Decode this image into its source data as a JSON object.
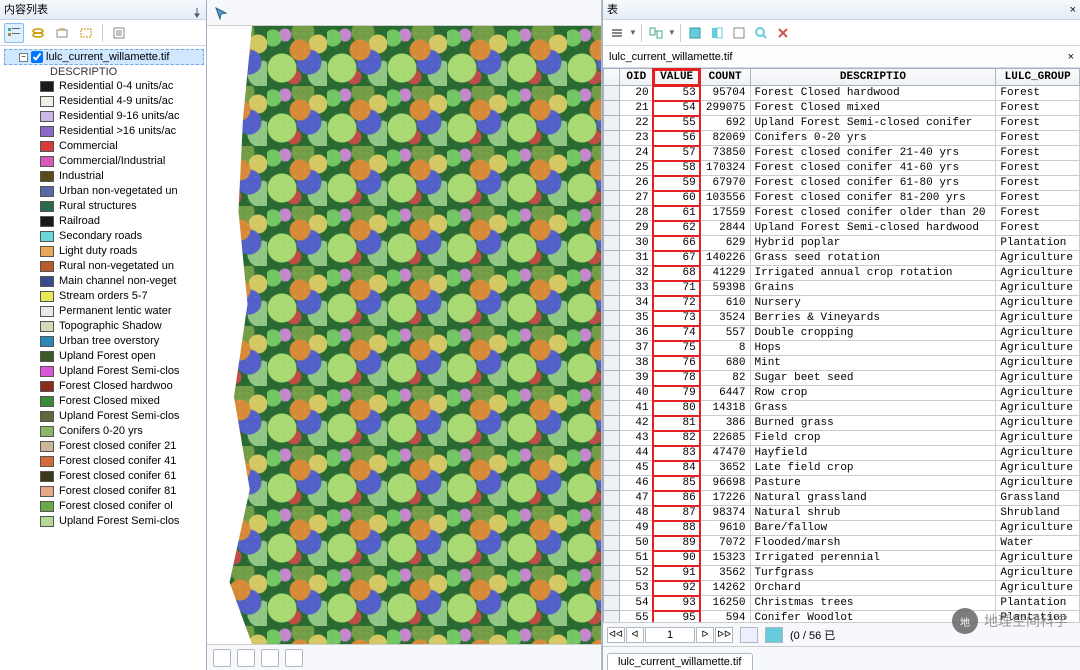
{
  "toc": {
    "title": "内容列表",
    "layerName": "lulc_current_willamette.tif",
    "legendHeader": "DESCRIPTIO",
    "legendItems": [
      {
        "color": "#1a1a1a",
        "label": "Residential 0-4 units/ac"
      },
      {
        "color": "#f0f0e8",
        "label": "Residential 4-9 units/ac"
      },
      {
        "color": "#c8b8e8",
        "label": "Residential 9-16 units/ac"
      },
      {
        "color": "#8a68c8",
        "label": "Residential >16 units/ac"
      },
      {
        "color": "#d83a3a",
        "label": "Commercial"
      },
      {
        "color": "#d858b8",
        "label": "Commercial/Industrial"
      },
      {
        "color": "#5a4a1a",
        "label": "Industrial"
      },
      {
        "color": "#5868a8",
        "label": "Urban non-vegetated un"
      },
      {
        "color": "#2a6a4a",
        "label": "Rural structures"
      },
      {
        "color": "#1a1a1a",
        "label": "Railroad"
      },
      {
        "color": "#68d8d8",
        "label": "Secondary roads"
      },
      {
        "color": "#e8a858",
        "label": "Light duty roads"
      },
      {
        "color": "#b85a2a",
        "label": "Rural non-vegetated un"
      },
      {
        "color": "#3a4a8a",
        "label": "Main channel non-veget"
      },
      {
        "color": "#e8e858",
        "label": "Stream orders 5-7"
      },
      {
        "color": "#e8e8e8",
        "label": "Permanent lentic water"
      },
      {
        "color": "#d8d8b8",
        "label": "Topographic Shadow"
      },
      {
        "color": "#2a88b8",
        "label": "Urban tree overstory"
      },
      {
        "color": "#3a5a2a",
        "label": "Upland Forest open"
      },
      {
        "color": "#d858d8",
        "label": "Upland Forest Semi-clos"
      },
      {
        "color": "#8a2a1a",
        "label": "Forest Closed hardwoo"
      },
      {
        "color": "#3a8a3a",
        "label": "Forest Closed mixed"
      },
      {
        "color": "#5a6a3a",
        "label": "Upland Forest Semi-clos"
      },
      {
        "color": "#8ab868",
        "label": "Conifers 0-20 yrs"
      },
      {
        "color": "#c8b898",
        "label": "Forest closed conifer 21"
      },
      {
        "color": "#d86a3a",
        "label": "Forest closed conifer 41"
      },
      {
        "color": "#3a3a1a",
        "label": "Forest closed conifer 61"
      },
      {
        "color": "#e8a888",
        "label": "Forest closed conifer 81"
      },
      {
        "color": "#6aa84a",
        "label": "Forest closed conifer ol"
      },
      {
        "color": "#b8d898",
        "label": "Upland Forest Semi-clos"
      }
    ]
  },
  "attributeTable": {
    "title": "表",
    "layerTab": "lulc_current_willamette.tif",
    "bottomTab": "lulc_current_willamette.tif",
    "columns": [
      "",
      "OID",
      "VALUE",
      "COUNT",
      "DESCRIPTIO",
      "LULC_GROUP"
    ],
    "navCurrent": "1",
    "navStatus": "(0 / 56 已",
    "rows": [
      {
        "oid": 20,
        "value": 53,
        "count": 95704,
        "desc": "Forest Closed hardwood",
        "group": "Forest"
      },
      {
        "oid": 21,
        "value": 54,
        "count": 299075,
        "desc": "Forest Closed mixed",
        "group": "Forest"
      },
      {
        "oid": 22,
        "value": 55,
        "count": 692,
        "desc": "Upland Forest Semi-closed conifer",
        "group": "Forest"
      },
      {
        "oid": 23,
        "value": 56,
        "count": 82069,
        "desc": "Conifers 0-20 yrs",
        "group": "Forest"
      },
      {
        "oid": 24,
        "value": 57,
        "count": 73850,
        "desc": "Forest closed conifer 21-40 yrs",
        "group": "Forest"
      },
      {
        "oid": 25,
        "value": 58,
        "count": 170324,
        "desc": "Forest closed conifer 41-60 yrs",
        "group": "Forest"
      },
      {
        "oid": 26,
        "value": 59,
        "count": 67970,
        "desc": "Forest closed conifer 61-80 yrs",
        "group": "Forest"
      },
      {
        "oid": 27,
        "value": 60,
        "count": 103556,
        "desc": "Forest closed conifer 81-200 yrs",
        "group": "Forest"
      },
      {
        "oid": 28,
        "value": 61,
        "count": 17559,
        "desc": "Forest closed conifer older than 20",
        "group": "Forest"
      },
      {
        "oid": 29,
        "value": 62,
        "count": 2844,
        "desc": "Upland Forest Semi-closed hardwood",
        "group": "Forest"
      },
      {
        "oid": 30,
        "value": 66,
        "count": 629,
        "desc": "Hybrid poplar",
        "group": "Plantation"
      },
      {
        "oid": 31,
        "value": 67,
        "count": 140226,
        "desc": "Grass seed rotation",
        "group": "Agriculture"
      },
      {
        "oid": 32,
        "value": 68,
        "count": 41229,
        "desc": "Irrigated annual crop rotation",
        "group": "Agriculture"
      },
      {
        "oid": 33,
        "value": 71,
        "count": 59398,
        "desc": "Grains",
        "group": "Agriculture"
      },
      {
        "oid": 34,
        "value": 72,
        "count": 610,
        "desc": "Nursery",
        "group": "Agriculture"
      },
      {
        "oid": 35,
        "value": 73,
        "count": 3524,
        "desc": "Berries & Vineyards",
        "group": "Agriculture"
      },
      {
        "oid": 36,
        "value": 74,
        "count": 557,
        "desc": "Double cropping",
        "group": "Agriculture"
      },
      {
        "oid": 37,
        "value": 75,
        "count": 8,
        "desc": "Hops",
        "group": "Agriculture"
      },
      {
        "oid": 38,
        "value": 76,
        "count": 680,
        "desc": "Mint",
        "group": "Agriculture"
      },
      {
        "oid": 39,
        "value": 78,
        "count": 82,
        "desc": "Sugar beet seed",
        "group": "Agriculture"
      },
      {
        "oid": 40,
        "value": 79,
        "count": 6447,
        "desc": "Row crop",
        "group": "Agriculture"
      },
      {
        "oid": 41,
        "value": 80,
        "count": 14318,
        "desc": "Grass",
        "group": "Agriculture"
      },
      {
        "oid": 42,
        "value": 81,
        "count": 386,
        "desc": "Burned grass",
        "group": "Agriculture"
      },
      {
        "oid": 43,
        "value": 82,
        "count": 22685,
        "desc": "Field crop",
        "group": "Agriculture"
      },
      {
        "oid": 44,
        "value": 83,
        "count": 47470,
        "desc": "Hayfield",
        "group": "Agriculture"
      },
      {
        "oid": 45,
        "value": 84,
        "count": 3652,
        "desc": "Late field crop",
        "group": "Agriculture"
      },
      {
        "oid": 46,
        "value": 85,
        "count": 96698,
        "desc": "Pasture",
        "group": "Agriculture"
      },
      {
        "oid": 47,
        "value": 86,
        "count": 17226,
        "desc": "Natural grassland",
        "group": "Grassland"
      },
      {
        "oid": 48,
        "value": 87,
        "count": 98374,
        "desc": "Natural shrub",
        "group": "Shrubland"
      },
      {
        "oid": 49,
        "value": 88,
        "count": 9610,
        "desc": "Bare/fallow",
        "group": "Agriculture"
      },
      {
        "oid": 50,
        "value": 89,
        "count": 7072,
        "desc": "Flooded/marsh",
        "group": "Water"
      },
      {
        "oid": 51,
        "value": 90,
        "count": 15323,
        "desc": "Irrigated perennial",
        "group": "Agriculture"
      },
      {
        "oid": 52,
        "value": 91,
        "count": 3562,
        "desc": "Turfgrass",
        "group": "Agriculture"
      },
      {
        "oid": 53,
        "value": 92,
        "count": 14262,
        "desc": "Orchard",
        "group": "Agriculture"
      },
      {
        "oid": 54,
        "value": 93,
        "count": 16250,
        "desc": "Christmas trees",
        "group": "Plantation"
      },
      {
        "oid": 55,
        "value": 95,
        "count": 594,
        "desc": "Conifer Woodlot",
        "group": "Plantation"
      }
    ]
  },
  "watermark": "地理空间科学"
}
